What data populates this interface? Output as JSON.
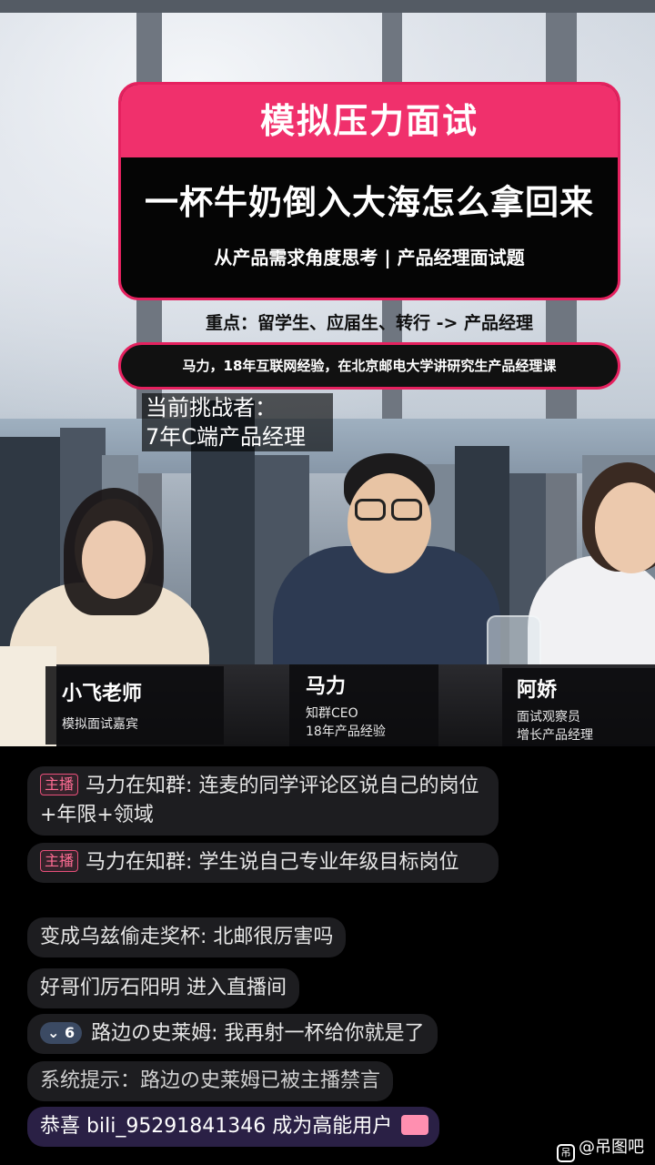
{
  "banner": {
    "category": "模拟压力面试",
    "question": "一杯牛奶倒入大海怎么拿回来",
    "subtitle": "从产品需求角度思考 | 产品经理面试题",
    "focus": "重点：留学生、应届生、转行 -> 产品经理",
    "host_intro": "马力，18年互联网经验，在北京邮电大学讲研究生产品经理课"
  },
  "challenger": {
    "label": "当前挑战者：",
    "role": "7年C端产品经理"
  },
  "people": [
    {
      "name": "小飞老师",
      "role_lines": [
        "模拟面试嘉宾"
      ]
    },
    {
      "name": "马力",
      "role_lines": [
        "知群CEO",
        "18年产品经验"
      ]
    },
    {
      "name": "阿娇",
      "role_lines": [
        "面试观察员",
        "增长产品经理"
      ]
    }
  ],
  "chat": {
    "messages": [
      {
        "badge": "主播",
        "user": "马力在知群",
        "text": "连麦的同学评论区说自己的岗位+年限+领域"
      },
      {
        "badge": "主播",
        "user": "马力在知群",
        "text": "学生说自己专业年级目标岗位"
      },
      {
        "user": "变成乌兹偷走奖杯",
        "text": "北邮很厉害吗"
      },
      {
        "user": "好哥们厉石阳明",
        "text": "进入直播间"
      },
      {
        "level": "6",
        "user": "路边の史莱姆",
        "text": "我再射一杯给你就是了"
      },
      {
        "text": "系统提示：路边の史莱姆已被主播禁言"
      },
      {
        "prefix": "恭喜",
        "user": "bili_95291841346",
        "text": "成为高能用户"
      }
    ]
  },
  "watermark": {
    "icon": "吊",
    "text": "@吊图吧"
  },
  "colors": {
    "accent": "#f0306c",
    "chat_bubble": "#1d1d20",
    "promo_bubble": "#2a2045"
  }
}
